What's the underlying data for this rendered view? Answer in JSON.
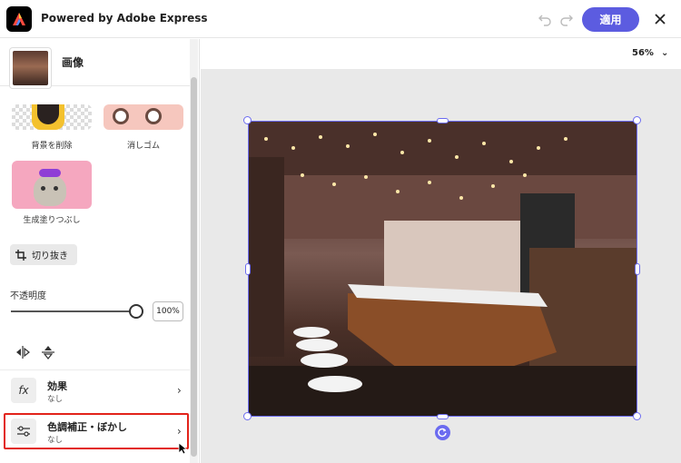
{
  "header": {
    "title": "Powered by Adobe Express",
    "apply_label": "適用",
    "icons": [
      "undo-icon",
      "redo-icon",
      "close-icon"
    ]
  },
  "panel": {
    "image_title": "画像",
    "tools": [
      {
        "label": "背景を削除"
      },
      {
        "label": "消しゴム"
      },
      {
        "label": "生成塗りつぶし"
      }
    ],
    "crop_label": "切り抜き",
    "opacity_label": "不透明度",
    "opacity_value": "100%",
    "opacity_fraction": 1.0,
    "effects": {
      "title": "効果",
      "sub": "なし"
    },
    "adjust": {
      "title": "色調補正・ぼかし",
      "sub": "なし"
    }
  },
  "canvas": {
    "zoom": "56%"
  },
  "colors": {
    "accent": "#5c5ce0",
    "selection": "#6b6bf0",
    "highlight": "#e2231a"
  }
}
